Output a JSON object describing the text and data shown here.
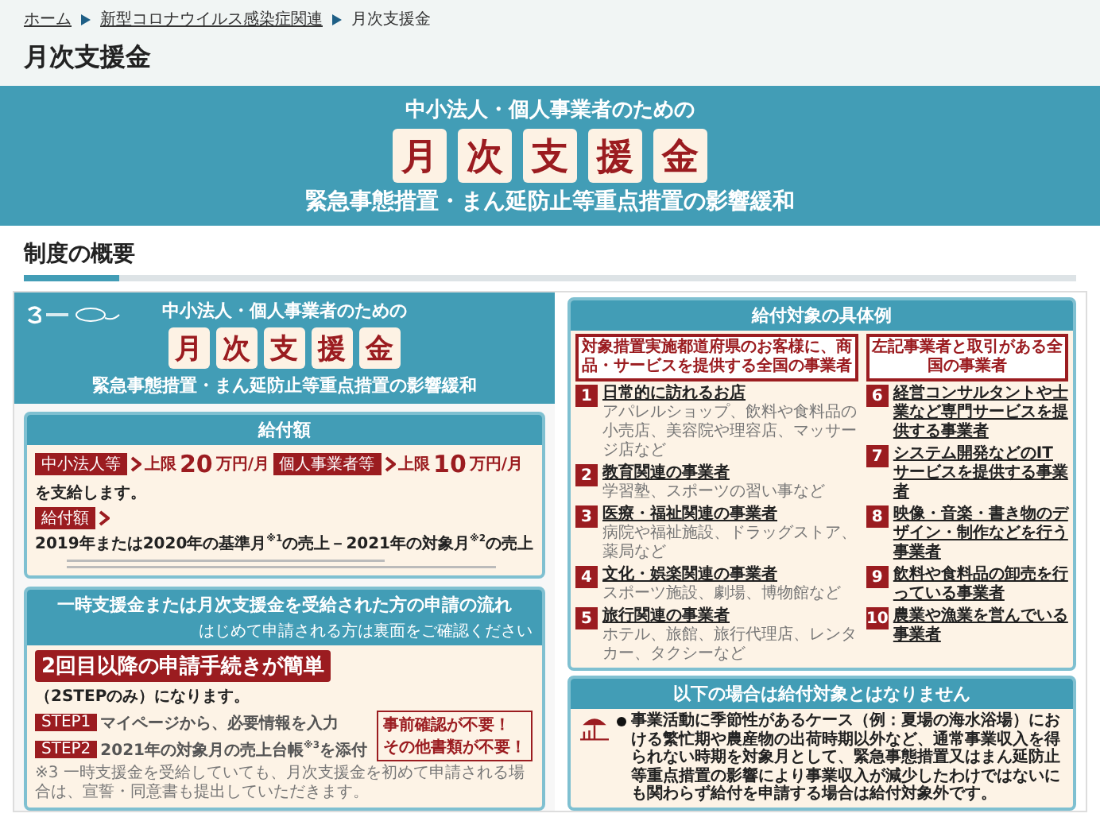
{
  "breadcrumb": [
    {
      "label": "ホーム",
      "link": true
    },
    {
      "label": "新型コロナウイルス感染症関連",
      "link": true
    },
    {
      "label": "月次支援金",
      "link": false
    }
  ],
  "page_title": "月次支援金",
  "hero": {
    "lead": "中小法人・個人事業者のための",
    "title_chars": [
      "月",
      "次",
      "支",
      "援",
      "金"
    ],
    "subtitle": "緊急事態措置・まん延防止等重点措置の影響緩和"
  },
  "section_heading": "制度の概要",
  "flyer": {
    "header": {
      "lead": "中小法人・個人事業者のための",
      "title_chars": [
        "月",
        "次",
        "支",
        "援",
        "金"
      ],
      "subtitle": "緊急事態措置・まん延防止等重点措置の影響緩和"
    },
    "amount": {
      "title": "給付額",
      "tiers": [
        {
          "tag": "中小法人等",
          "prefix": "上限",
          "amount": "20",
          "unit": "万円/月"
        },
        {
          "tag": "個人事業者等",
          "prefix": "上限",
          "amount": "10",
          "unit": "万円/月"
        }
      ],
      "suffix": "を支給します。",
      "formula_tag": "給付額",
      "formula": "2019年または2020年の基準月$^{※1}$の売上－2021年の対象月$^{※2}$の売上"
    },
    "flow": {
      "title": "一時支援金または月次支援金を受給された方の申請の流れ",
      "note": "はじめて申請される方は裏面をご確認ください",
      "headline": "2回目以降の申請手続きが簡単",
      "headline_suffix": "（2STEPのみ）になります。",
      "steps": [
        {
          "label": "STEP1",
          "text": "マイページから、**必要情報を入力**"
        },
        {
          "label": "STEP2",
          "text": "**2021年の対象月の売上台帳**$^{※3}$を添付"
        }
      ],
      "callout": [
        "事前確認が不要！",
        "その他書類が不要！"
      ],
      "footnote": "※3 一時支援金を受給していても、月次支援金を初めて申請される場合は、宣誓・同意書も提出していただきます。"
    },
    "examples": {
      "title": "給付対象の具体例",
      "groups": [
        {
          "heading": "対象措置実施都道府県のお客様に、商品・サービスを提供する全国の事業者",
          "items": [
            {
              "number": "1",
              "title": "日常的に訪れるお店",
              "description": "アパレルショップ、飲料や食料品の小売店、美容院や理容店、マッサージ店など"
            },
            {
              "number": "2",
              "title": "教育関連の事業者",
              "description": "学習塾、スポーツの習い事など"
            },
            {
              "number": "3",
              "title": "医療・福祉関連の事業者",
              "description": "病院や福祉施設、ドラッグストア、薬局など"
            },
            {
              "number": "4",
              "title": "文化・娯楽関連の事業者",
              "description": "スポーツ施設、劇場、博物館など"
            },
            {
              "number": "5",
              "title": "旅行関連の事業者",
              "description": "ホテル、旅館、旅行代理店、レンタカー、タクシーなど"
            }
          ]
        },
        {
          "heading": "左記事業者と取引がある全国の事業者",
          "items": [
            {
              "number": "6",
              "title": "経営コンサルタントや士業など専門サービスを提供する事業者"
            },
            {
              "number": "7",
              "title": "システム開発などのITサービスを提供する事業者"
            },
            {
              "number": "8",
              "title": "映像・音楽・書き物のデザイン・制作などを行う事業者"
            },
            {
              "number": "9",
              "title": "飲料や食料品の卸売を行っている事業者"
            },
            {
              "number": "10",
              "title": "農業や漁業を営んでいる事業者"
            }
          ]
        }
      ]
    },
    "exclusions": {
      "title": "以下の場合は給付対象とはなりません",
      "text": "事業活動に季節性があるケース（例：夏場の海水浴場）における繁忙期や農産物の出荷時期以外など、**通常事業収入を得られない時期を対象月として、緊急事態措置又はまん延防止等重点措置の影響により事業収入が減少したわけではないにも関わらず給付を申請する場合は給付対象外です。**"
    }
  }
}
